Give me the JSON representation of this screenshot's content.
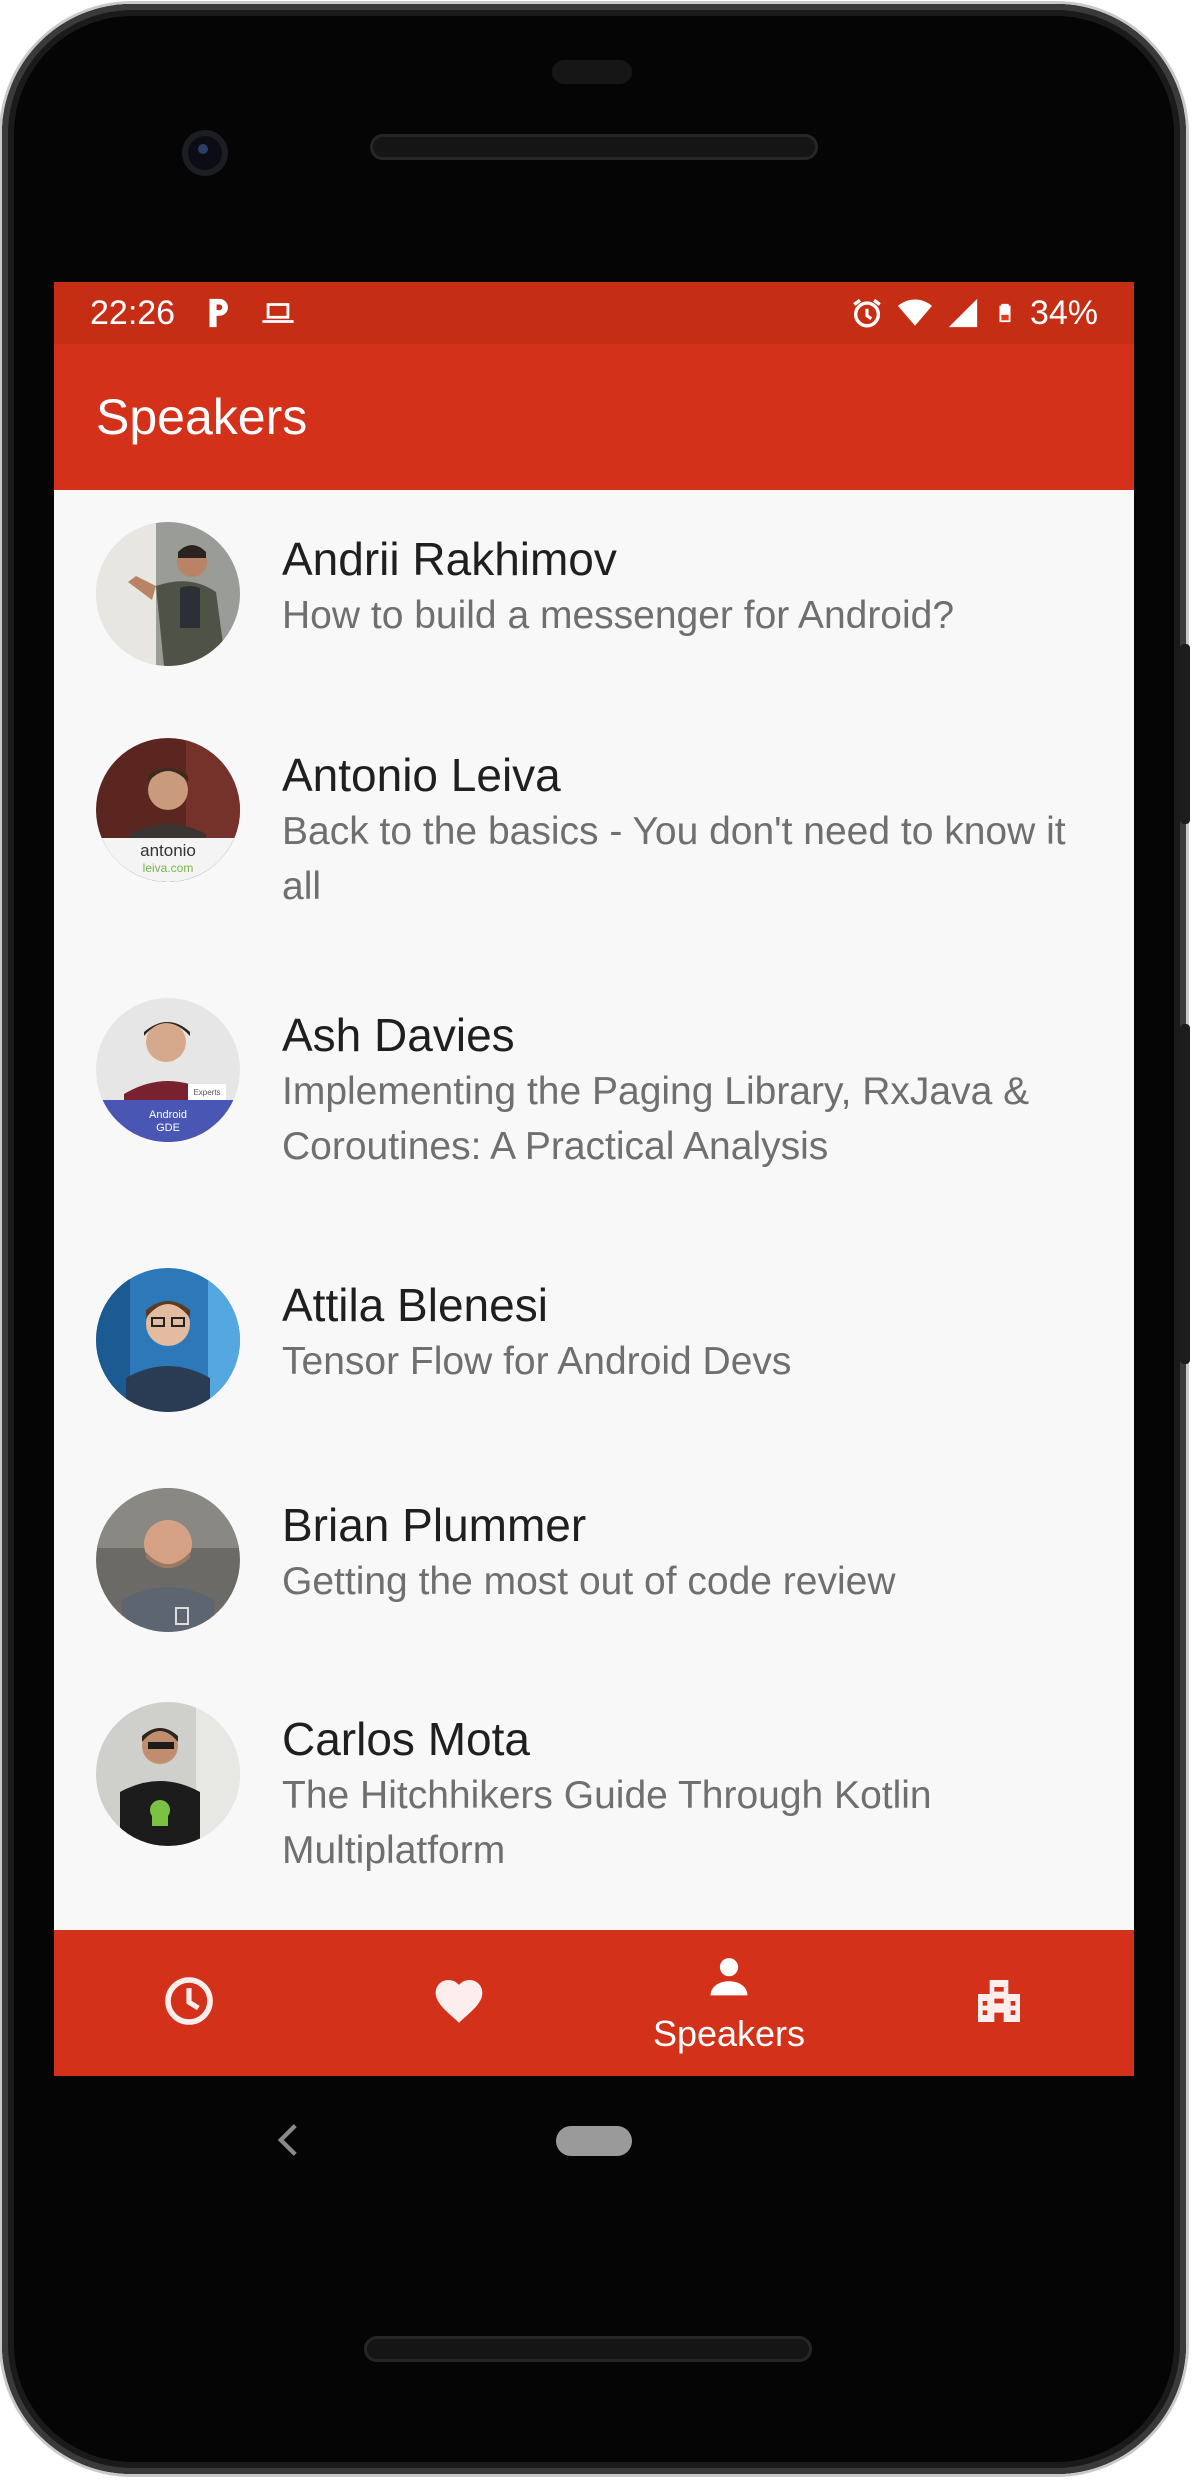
{
  "status_bar": {
    "time": "22:26",
    "battery": "34%",
    "icons": [
      "parking-icon",
      "laptop-icon",
      "alarm-icon",
      "wifi-icon",
      "signal-icon",
      "battery-icon"
    ]
  },
  "app_bar": {
    "title": "Speakers"
  },
  "speakers": [
    {
      "name": "Andrii Rakhimov",
      "talk": "How to build a messenger for Android?"
    },
    {
      "name": "Antonio Leiva",
      "talk": "Back to the basics - You don't need to know it all"
    },
    {
      "name": "Ash Davies",
      "talk": "Implementing the Paging Library, RxJava & Coroutines: A Practical Analysis"
    },
    {
      "name": "Attila Blenesi",
      "talk": "Tensor Flow for Android Devs"
    },
    {
      "name": "Brian Plummer",
      "talk": "Getting the most out of code review"
    },
    {
      "name": "Carlos Mota",
      "talk": "The Hitchhikers Guide Through Kotlin Multiplatform"
    }
  ],
  "avatar_texts": {
    "antonio_logo_line1": "antonio",
    "antonio_logo_line2": "leiva.com",
    "ash_badge_line1": "Android",
    "ash_badge_line2": "GDE",
    "ash_badge_small": "Experts"
  },
  "bottom_nav": {
    "items": [
      {
        "icon": "clock-icon",
        "label": ""
      },
      {
        "icon": "heart-icon",
        "label": ""
      },
      {
        "icon": "person-icon",
        "label": "Speakers",
        "active": true
      },
      {
        "icon": "building-icon",
        "label": ""
      }
    ]
  },
  "colors": {
    "primary": "#d4311a",
    "status_bar": "#c62d15",
    "list_background": "#f8f8f8",
    "name_text": "#1f1f1f",
    "talk_text": "#6f6f6f"
  }
}
